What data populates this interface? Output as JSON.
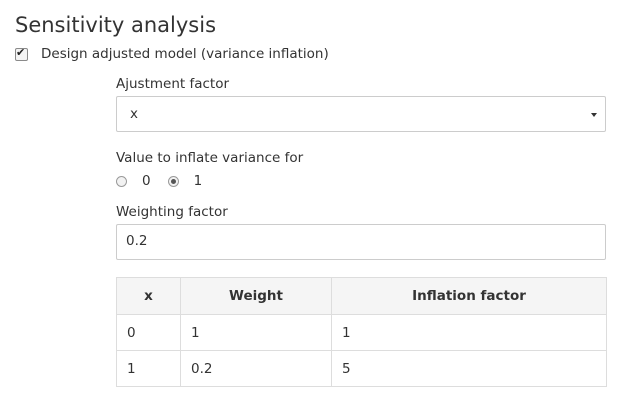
{
  "section": {
    "title": "Sensitivity analysis"
  },
  "design_checkbox": {
    "label": "Design adjusted model (variance inflation)",
    "checked": true
  },
  "adjustment": {
    "label": "Ajustment factor",
    "selected": "x"
  },
  "inflate": {
    "label": "Value to inflate variance for",
    "options": [
      "0",
      "1"
    ],
    "selected": "1"
  },
  "weighting": {
    "label": "Weighting factor",
    "value": "0.2"
  },
  "table": {
    "headers": [
      "x",
      "Weight",
      "Inflation factor"
    ],
    "rows": [
      [
        "0",
        "1",
        "1"
      ],
      [
        "1",
        "0.2",
        "5"
      ]
    ]
  },
  "icons": {
    "select_caret": "caret-down-icon",
    "check": "check-icon"
  }
}
